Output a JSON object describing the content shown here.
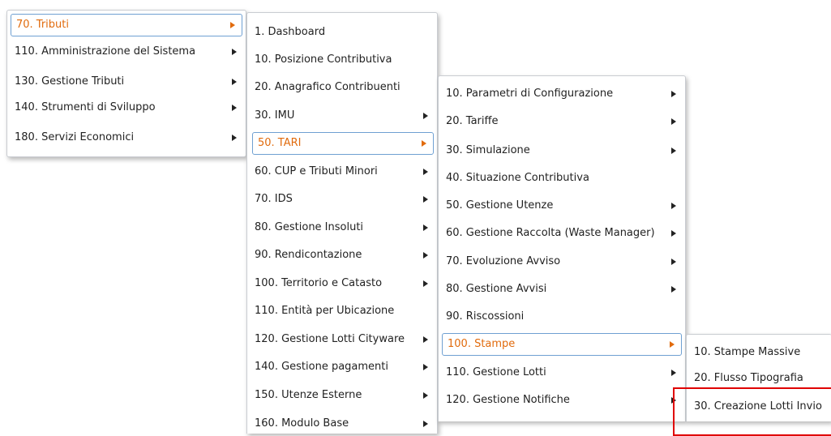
{
  "menus": {
    "level1": {
      "items": [
        {
          "label": "70. Tributi",
          "submenu": true,
          "active": true
        },
        {
          "label": "110. Amministrazione del Sistema",
          "submenu": true
        },
        {
          "label": "130. Gestione Tributi",
          "submenu": true
        },
        {
          "label": "140. Strumenti di Sviluppo",
          "submenu": true
        },
        {
          "label": "180. Servizi Economici",
          "submenu": true
        }
      ]
    },
    "level2": {
      "items": [
        {
          "label": "1. Dashboard",
          "submenu": false
        },
        {
          "label": "10. Posizione Contributiva",
          "submenu": false
        },
        {
          "label": "20. Anagrafico Contribuenti",
          "submenu": false
        },
        {
          "label": "30. IMU",
          "submenu": true
        },
        {
          "label": "50. TARI",
          "submenu": true,
          "active": true
        },
        {
          "label": "60. CUP e Tributi Minori",
          "submenu": true
        },
        {
          "label": "70. IDS",
          "submenu": true
        },
        {
          "label": "80. Gestione Insoluti",
          "submenu": true
        },
        {
          "label": "90. Rendicontazione",
          "submenu": true
        },
        {
          "label": "100. Territorio e Catasto",
          "submenu": true
        },
        {
          "label": "110. Entità per Ubicazione",
          "submenu": false
        },
        {
          "label": "120. Gestione Lotti Cityware",
          "submenu": true
        },
        {
          "label": "140. Gestione pagamenti",
          "submenu": true
        },
        {
          "label": "150. Utenze Esterne",
          "submenu": true
        },
        {
          "label": "160. Modulo Base",
          "submenu": true
        }
      ]
    },
    "level3": {
      "items": [
        {
          "label": "10. Parametri di Configurazione",
          "submenu": true
        },
        {
          "label": "20. Tariffe",
          "submenu": true
        },
        {
          "label": "30. Simulazione",
          "submenu": true
        },
        {
          "label": "40. Situazione Contributiva",
          "submenu": false
        },
        {
          "label": "50. Gestione Utenze",
          "submenu": true
        },
        {
          "label": "60. Gestione Raccolta (Waste Manager)",
          "submenu": true
        },
        {
          "label": "70. Evoluzione Avviso",
          "submenu": true
        },
        {
          "label": "80. Gestione Avvisi",
          "submenu": true
        },
        {
          "label": "90. Riscossioni",
          "submenu": false
        },
        {
          "label": "100. Stampe",
          "submenu": true,
          "active": true
        },
        {
          "label": "110. Gestione Lotti",
          "submenu": true
        },
        {
          "label": "120. Gestione Notifiche",
          "submenu": true
        }
      ]
    },
    "level4": {
      "items": [
        {
          "label": "10. Stampe Massive",
          "submenu": false
        },
        {
          "label": "20. Flusso Tipografia",
          "submenu": false
        },
        {
          "label": "30. Creazione Lotti Invio",
          "submenu": false,
          "highlighted": true
        }
      ]
    }
  },
  "colors": {
    "active_text": "#e16b0d",
    "active_border": "#6fa0d2",
    "highlight_border": "#e00000"
  }
}
